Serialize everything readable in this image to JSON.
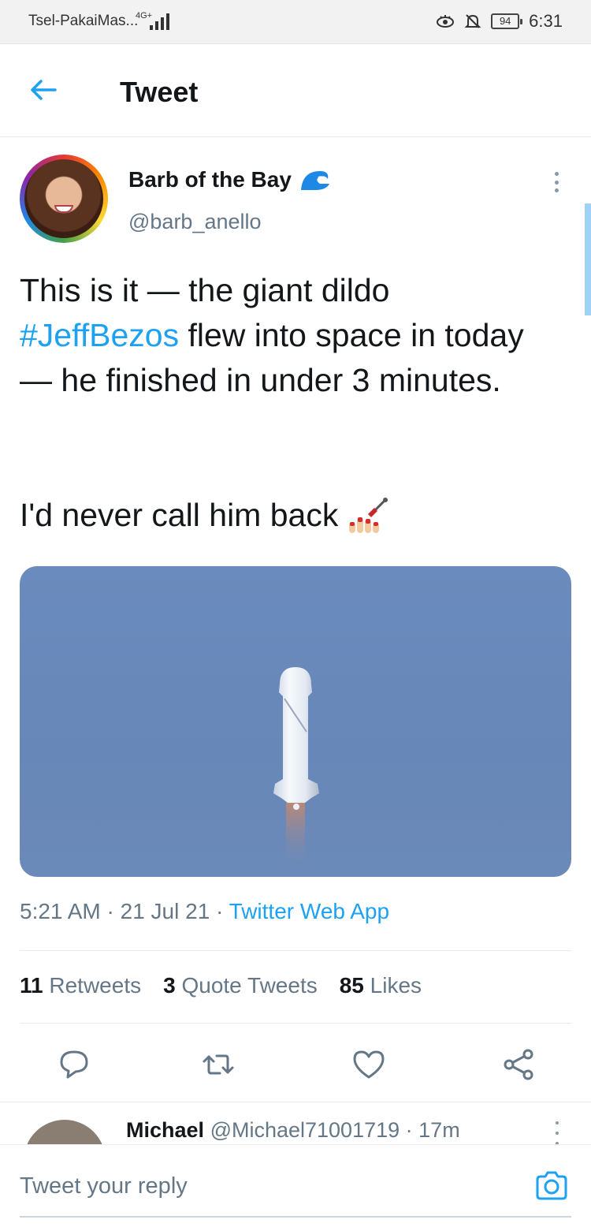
{
  "status_bar": {
    "carrier": "Tsel-PakaiMas...",
    "network": "4G+",
    "battery": "94",
    "time": "6:31"
  },
  "header": {
    "title": "Tweet"
  },
  "tweet": {
    "author_name": "Barb of the Bay",
    "author_handle": "@barb_anello",
    "text_before": "This is it — the giant dildo ",
    "hashtag": "#JeffBezos",
    "text_after": " flew into space in today — he finished in under 3 minutes.",
    "text2": "I'd never call him back",
    "time": "5:21 AM",
    "date": "21 Jul 21",
    "source": "Twitter Web App",
    "stats": {
      "retweets_count": "11",
      "retweets_label": "Retweets",
      "quotes_count": "3",
      "quotes_label": "Quote Tweets",
      "likes_count": "85",
      "likes_label": "Likes"
    }
  },
  "reply_preview": {
    "name": "Michael",
    "handle": "@Michael71001719",
    "time": "17m"
  },
  "reply_bar": {
    "placeholder": "Tweet your reply"
  },
  "icons": {
    "back": "back-arrow-icon",
    "reply": "reply-icon",
    "retweet": "retweet-icon",
    "like": "heart-icon",
    "share": "share-icon",
    "camera": "camera-icon"
  },
  "colors": {
    "accent": "#1da1f2",
    "secondary_text": "#657786",
    "sky": "#6787b8"
  }
}
